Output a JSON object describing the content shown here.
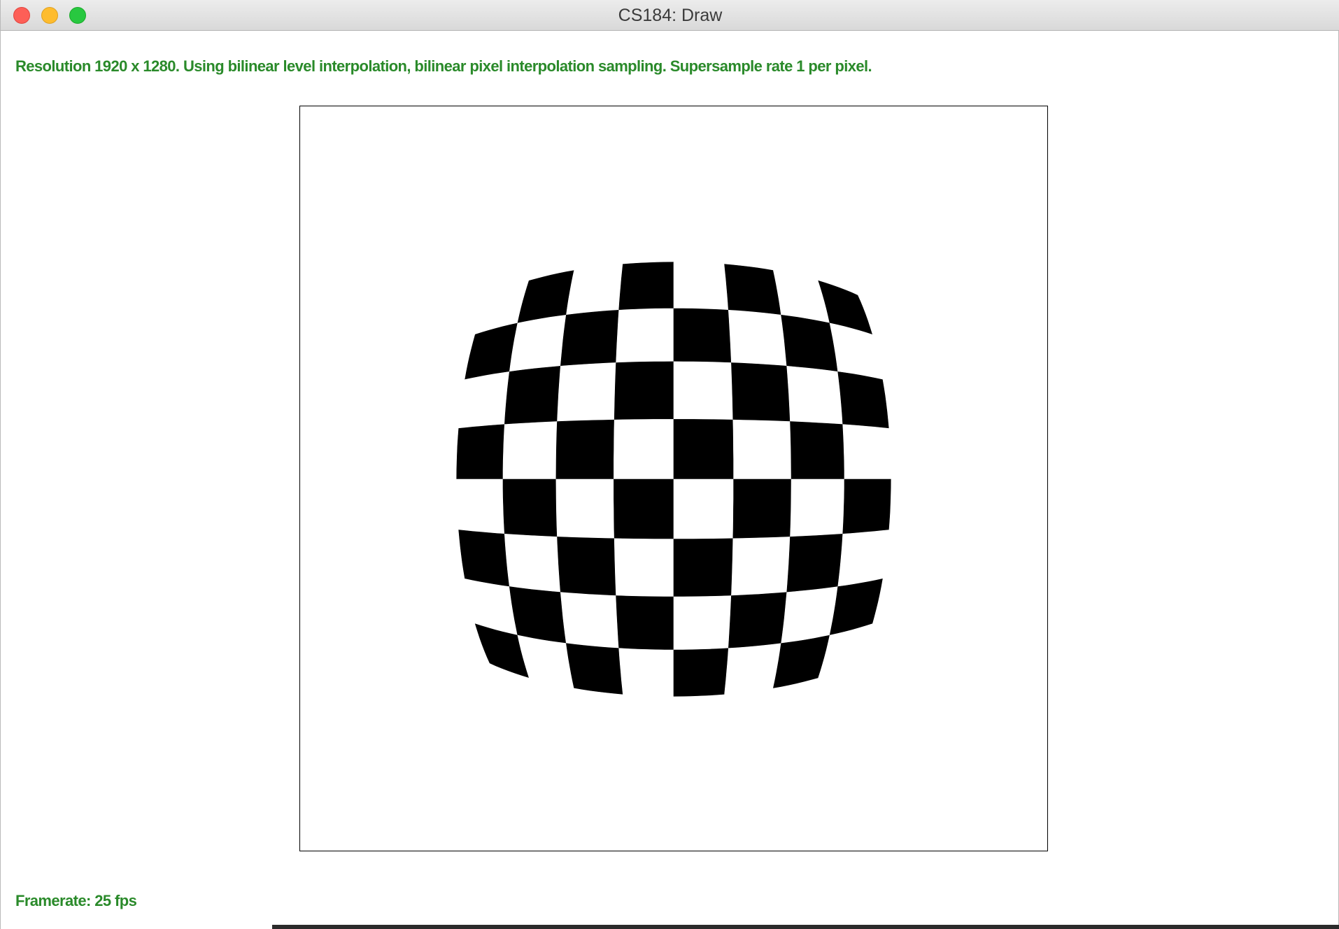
{
  "window": {
    "title": "CS184: Draw",
    "controls": {
      "close": "close-button",
      "minimize": "minimize-button",
      "zoom": "zoom-button"
    }
  },
  "status": {
    "text": "Resolution 1920 x 1280. Using bilinear level interpolation, bilinear pixel interpolation sampling. Supersample rate 1 per pixel.",
    "color": "#2a8a2a"
  },
  "footer": {
    "framerate": "Framerate: 25 fps"
  },
  "canvas": {
    "content": "warped-checkerboard",
    "grid_cells": 8,
    "colors": {
      "dark": "#000000",
      "light": "#ffffff"
    }
  }
}
